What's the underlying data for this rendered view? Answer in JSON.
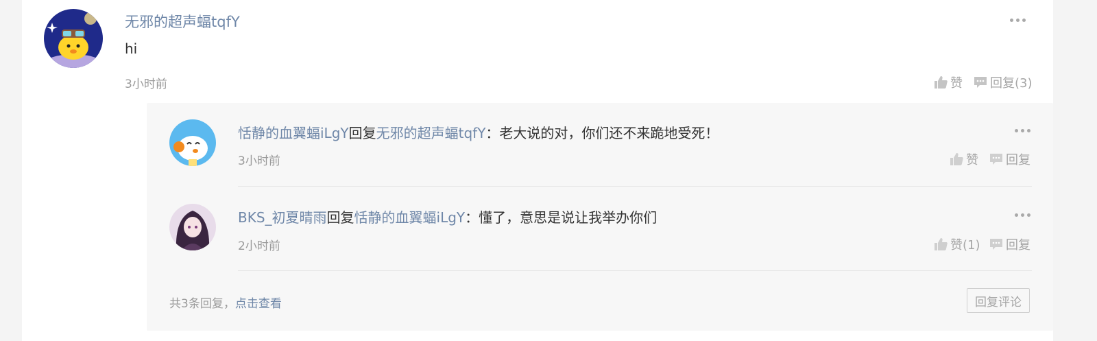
{
  "comment": {
    "username": "无邪的超声蝠tqfY",
    "text": "hi",
    "time": "3小时前",
    "like_label": "赞",
    "reply_label": "回复(3)"
  },
  "replies": [
    {
      "username": "恬静的血翼蝠iLgY",
      "verb": "回复",
      "target": "无邪的超声蝠tqfY",
      "text": "：老大说的对，你们还不来跪地受死！",
      "time": "3小时前",
      "like_label": "赞",
      "reply_label": "回复"
    },
    {
      "username": "BKS_初夏晴雨",
      "verb": "回复",
      "target": "恬静的血翼蝠iLgY",
      "text": "：懂了，意思是说让我举办你们",
      "time": "2小时前",
      "like_label": "赞(1)",
      "reply_label": "回复"
    }
  ],
  "footer": {
    "total_prefix": "共3条回复，",
    "view_link": "点击查看",
    "reply_button": "回复评论"
  },
  "icons": {
    "like": "thumbs-up-icon",
    "reply": "speech-bubble-icon",
    "more": "more-dots-icon"
  },
  "colors": {
    "link": "#6f87a8",
    "meta": "#9a9a9a",
    "panel": "#f7f7f7"
  }
}
